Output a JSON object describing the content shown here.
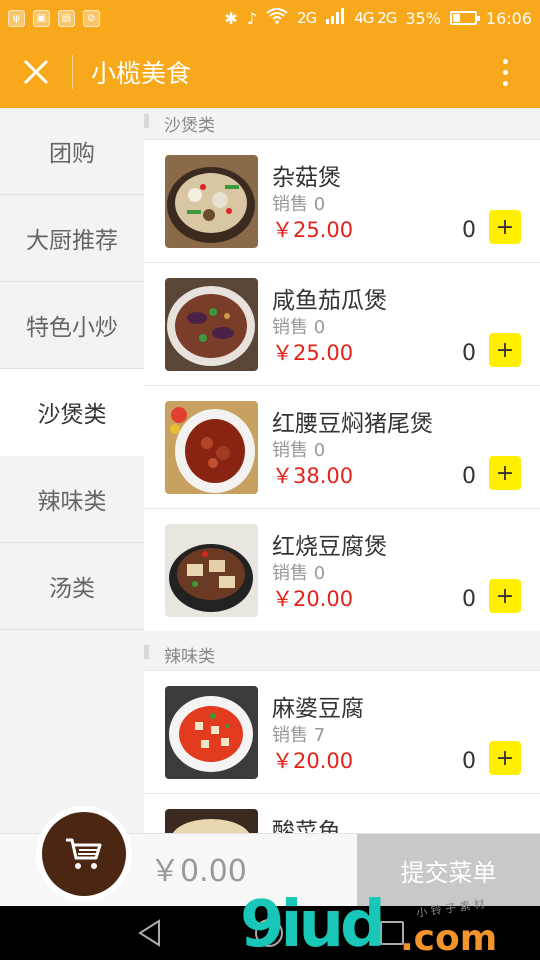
{
  "status_bar": {
    "time": "16:06",
    "battery": "35%",
    "battery_level": 0.35,
    "network_a": "2G",
    "network_b": "4G 2G",
    "icons": [
      "usb-icon",
      "image-icon",
      "clipboard-icon",
      "no-disturb-icon",
      "bluetooth-icon",
      "silent-icon",
      "wifi-icon",
      "signal-icon",
      "battery-icon"
    ]
  },
  "header": {
    "title": "小榄美食",
    "close_icon": "close-icon",
    "more_icon": "more-vertical-icon"
  },
  "sidebar": {
    "items": [
      {
        "label": "团购",
        "active": false
      },
      {
        "label": "大厨推荐",
        "active": false
      },
      {
        "label": "特色小炒",
        "active": false
      },
      {
        "label": "沙煲类",
        "active": true
      },
      {
        "label": "辣味类",
        "active": false
      },
      {
        "label": "汤类",
        "active": false
      }
    ]
  },
  "sections": [
    {
      "title": "沙煲类",
      "items": [
        {
          "name": "杂菇煲",
          "sales": "销售 0",
          "price": "￥25.00",
          "qty": "0",
          "add": "+"
        },
        {
          "name": "咸鱼茄瓜煲",
          "sales": "销售 0",
          "price": "￥25.00",
          "qty": "0",
          "add": "+"
        },
        {
          "name": "红腰豆焖猪尾煲",
          "sales": "销售 0",
          "price": "￥38.00",
          "qty": "0",
          "add": "+"
        },
        {
          "name": "红烧豆腐煲",
          "sales": "销售 0",
          "price": "￥20.00",
          "qty": "0",
          "add": "+"
        }
      ]
    },
    {
      "title": "辣味类",
      "items": [
        {
          "name": "麻婆豆腐",
          "sales": "销售 7",
          "price": "￥20.00",
          "qty": "0",
          "add": "+"
        },
        {
          "name": "酸菜鱼",
          "sales": "",
          "price": "",
          "qty": "",
          "add": ""
        }
      ]
    }
  ],
  "cart": {
    "total": "￥0.00",
    "submit_label": "提交菜单",
    "cart_icon": "shopping-cart-icon"
  },
  "nav": {
    "icons": [
      "back-icon",
      "home-icon",
      "recent-apps-icon"
    ]
  },
  "watermark": {
    "brand": "9iud",
    "domain": ".com",
    "small": "小 铃 子 素 材"
  },
  "colors": {
    "accent": "#f7a81b",
    "price": "#e2231a",
    "add_button": "#ffef00",
    "cart": "#4a2613"
  }
}
